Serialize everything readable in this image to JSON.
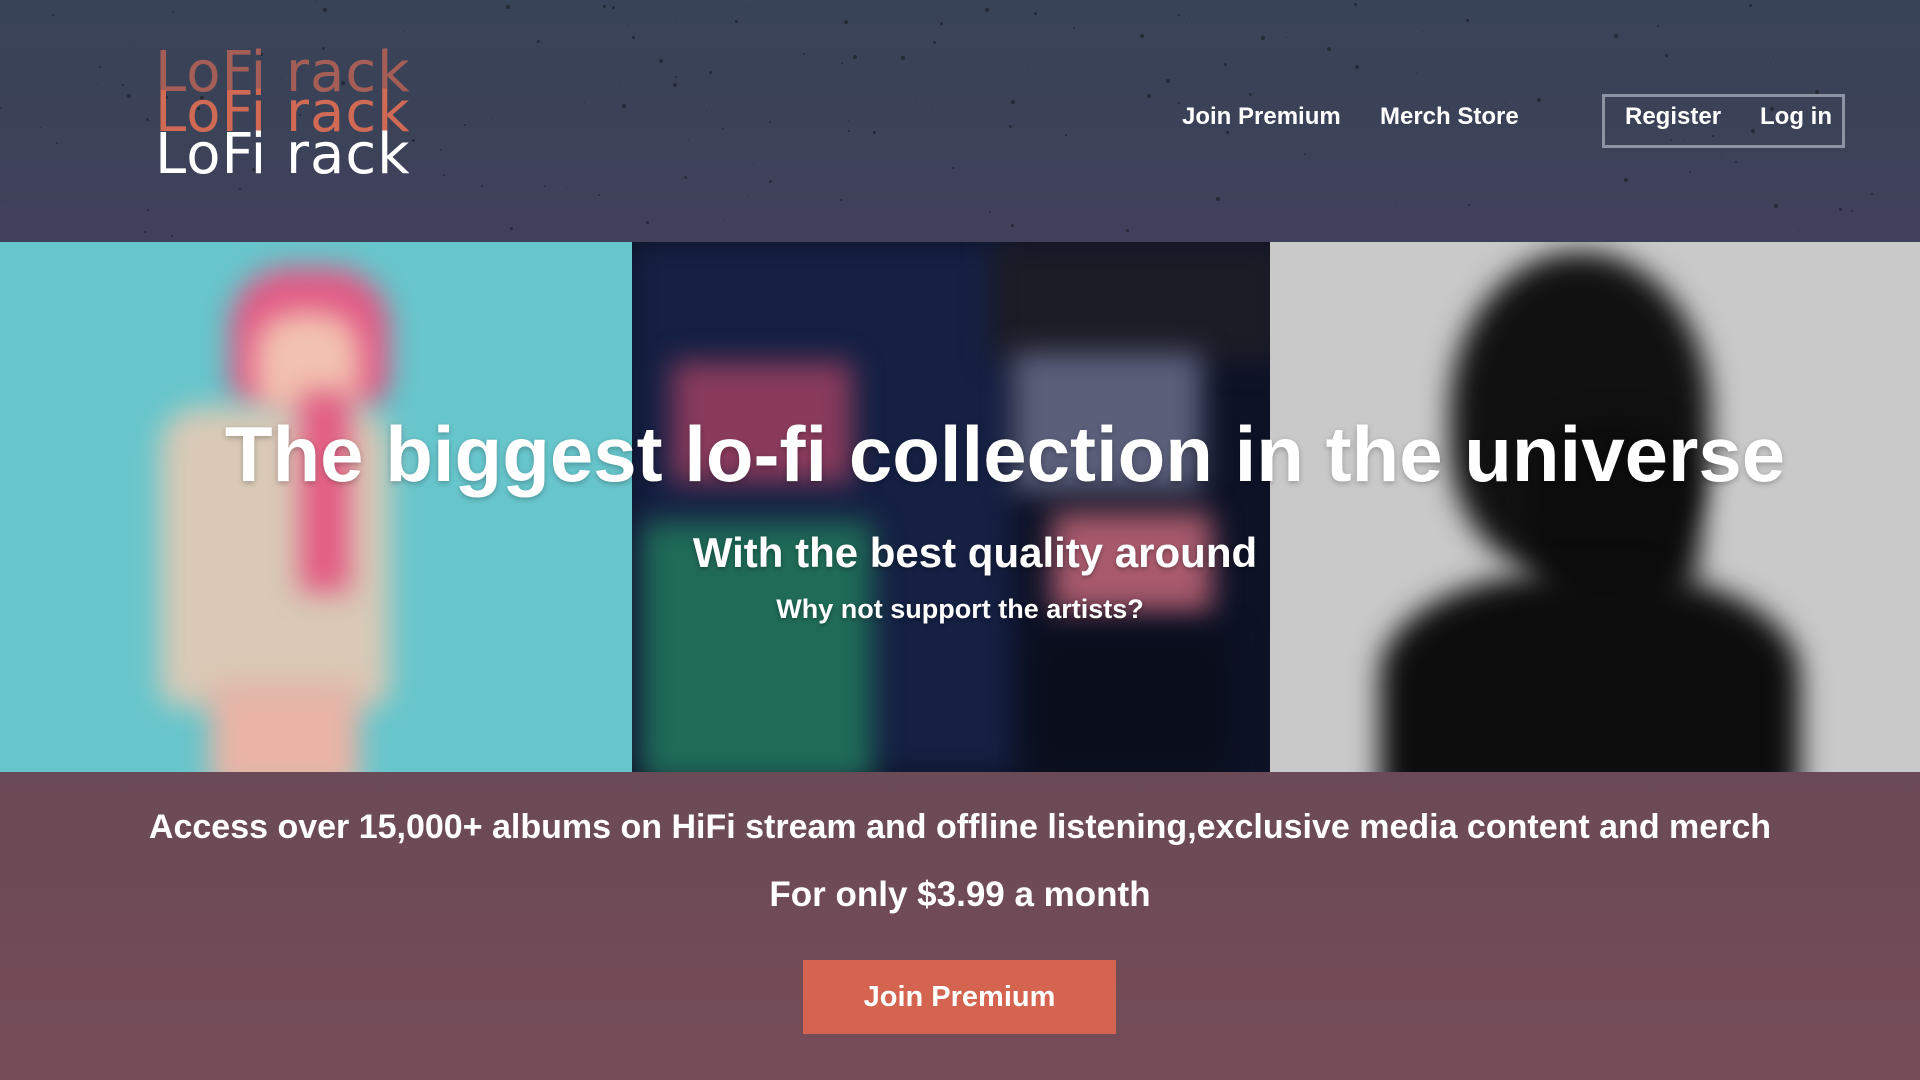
{
  "brand": {
    "logo_text": "LoFi rack"
  },
  "nav": {
    "join_premium": "Join Premium",
    "merch_store": "Merch Store",
    "register": "Register",
    "login": "Log in"
  },
  "hero": {
    "title": "The biggest lo-fi collection in the universe",
    "subtitle": "With the best quality around",
    "tagline": "Why not support the artists?"
  },
  "offer": {
    "description": "Access over 15,000+ albums on HiFi stream and offline listening,exclusive media content and merch",
    "price_line": "For only $3.99 a month",
    "cta_label": "Join Premium"
  },
  "colors": {
    "header_bg": "#3b4258",
    "offer_bg": "#6f4b57",
    "accent": "#d4644f",
    "text": "#ffffff"
  }
}
